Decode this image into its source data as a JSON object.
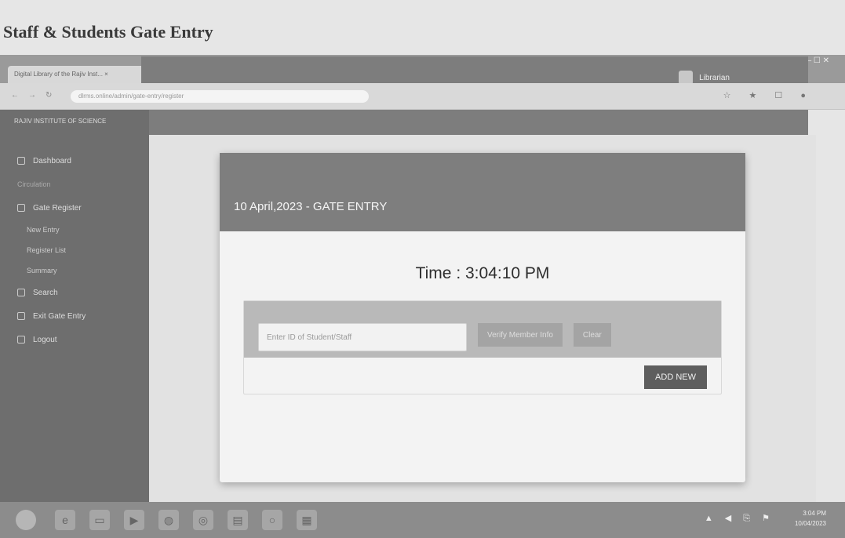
{
  "document": {
    "heading": "Staff & Students Gate Entry"
  },
  "browser": {
    "tab_title": "Digital Library of the Rajiv Inst...",
    "tab_close": "×",
    "url": "dlrms.online/admin/gate-entry/register",
    "nav_glyphs": [
      "←",
      "→",
      "↻"
    ],
    "window_controls": "—  ☐  ✕",
    "extensions": "☆ ★ ☐ ●"
  },
  "app": {
    "brand": "RAJIV INSTITUTE OF SCIENCE",
    "user_label": "Librarian"
  },
  "sidebar": {
    "items": [
      {
        "label": "Dashboard",
        "icon": "dashboard-icon",
        "kind": "main"
      },
      {
        "label": "Circulation",
        "icon": "",
        "kind": "header"
      },
      {
        "label": "Gate Register",
        "icon": "register-icon",
        "kind": "main"
      },
      {
        "label": "New Entry",
        "icon": "",
        "kind": "sub"
      },
      {
        "label": "Register List",
        "icon": "",
        "kind": "sub"
      },
      {
        "label": "Summary",
        "icon": "",
        "kind": "sub"
      },
      {
        "label": "Search",
        "icon": "search-icon",
        "kind": "main"
      },
      {
        "label": "Exit Gate Entry",
        "icon": "exit-icon",
        "kind": "main"
      },
      {
        "label": "Logout",
        "icon": "logout-icon",
        "kind": "main"
      }
    ]
  },
  "gate_entry": {
    "title": "10 April,2023 - GATE ENTRY",
    "time_label": "Time :",
    "time_value": "3:04:10 PM",
    "input_placeholder": "Enter ID of Student/Staff",
    "submit_label": "Verify Member Info",
    "clear_label": "Clear",
    "add_new_label": "ADD NEW"
  },
  "taskbar": {
    "tray_icons": "▲ ◀ ⎘ ⚑",
    "clock_time": "3:04 PM",
    "clock_date": "10/04/2023"
  }
}
